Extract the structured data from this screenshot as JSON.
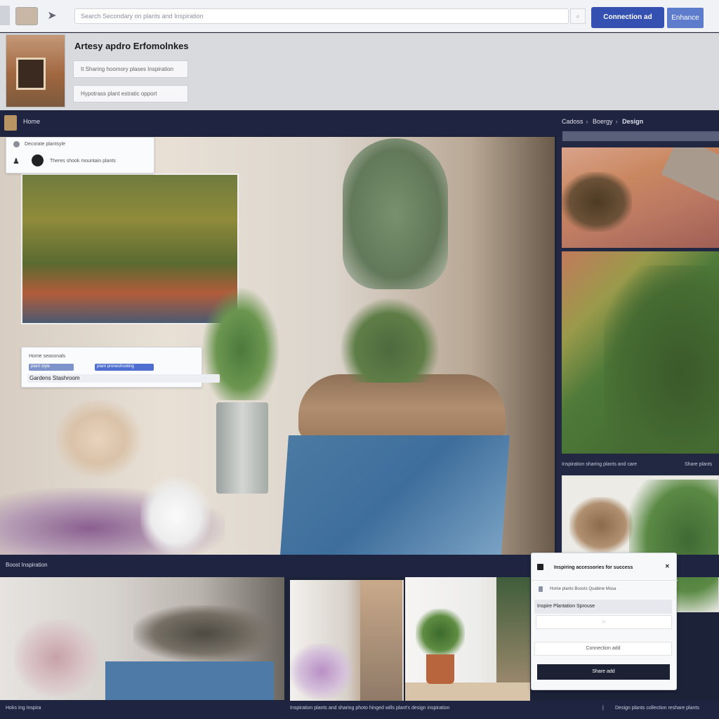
{
  "topbar": {
    "search_placeholder": "Search Secondary on plants and Inspiration",
    "search_go": "⌕",
    "primary_button": "Connection ad",
    "secondary_button": "Enhance"
  },
  "header": {
    "title": "Artesy apdro Erfomolnkes",
    "field1": "It Sharing hoomory plases Inspiration",
    "field2": "Hypotrass plant estratic opport"
  },
  "appbar": {
    "app_name": "Home",
    "breadcrumb": [
      "Cadoss",
      "Boergy",
      "Design"
    ]
  },
  "hero_cards": {
    "top": {
      "row1": "Decorate plantsyle",
      "row2": "Theres shook mountain plants"
    },
    "mid": {
      "label": "Home seasonals",
      "pill_a": "plant style",
      "pill_b": "plant proneshooting",
      "bar": "Gardens Stashroom"
    }
  },
  "sidebar": {
    "caption_left": "Inspiration sharing plants and care",
    "caption_right": "Share plants"
  },
  "midbar": {
    "label": "Boost Inspiration"
  },
  "popover": {
    "header": "Inspiring accessories for success",
    "close": "✕",
    "option1": "Home plants Boosts Quabine Mosa",
    "option2": "Inspire Plantation Sprouse",
    "input_placeholder": "○",
    "secondary_button": "Connection add",
    "primary_button": "Share add"
  },
  "footer": {
    "left": "Hoks Ing Inspira",
    "center": "Inspiration plants and sharing photo hinged wills plant's design inspiration",
    "sep": "|",
    "right": "Design plants collection reshare plants"
  },
  "colors": {
    "primary": "#3451b2",
    "secondary": "#5d7ccc",
    "appbar": "#1f2540",
    "dark_button": "#1c2133"
  }
}
